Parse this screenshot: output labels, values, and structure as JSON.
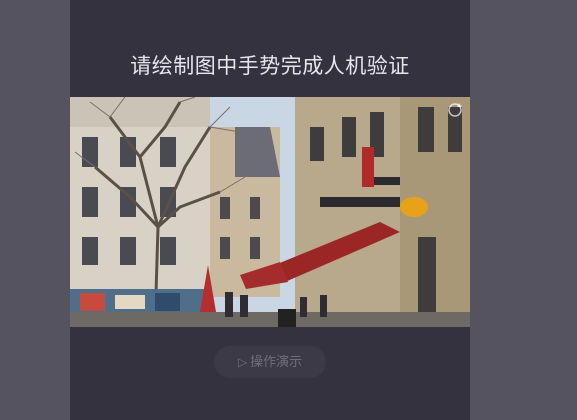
{
  "captcha": {
    "title": "请绘制图中手势完成人机验证",
    "demo_label": "操作演示",
    "demo_icon": "play-icon",
    "refresh_icon": "refresh-icon",
    "scene_description": "street-scene-image"
  },
  "colors": {
    "page_bg": "#54535f",
    "panel_bg": "#33323e",
    "title_text": "#e6e6ea",
    "button_bg": "#3b3a46",
    "button_text": "#6f6e7c"
  }
}
